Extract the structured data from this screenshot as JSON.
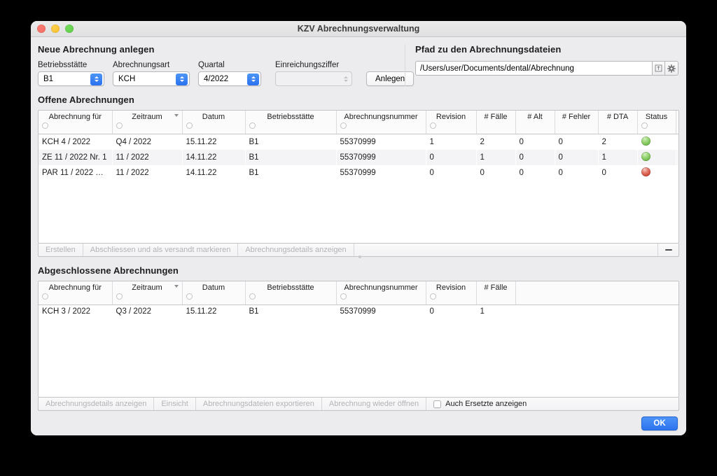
{
  "window": {
    "title": "KZV Abrechnungsverwaltung",
    "traffic_lights": [
      "close",
      "minimize",
      "zoom"
    ],
    "accent_color": "#2d74f0"
  },
  "new_billing": {
    "section_title": "Neue Abrechnung anlegen",
    "fields": [
      {
        "label": "Betriebsstätte",
        "value": "B1",
        "type": "popup"
      },
      {
        "label": "Abrechnungsart",
        "value": "KCH",
        "type": "popup"
      },
      {
        "label": "Quartal",
        "value": "4/2022",
        "type": "popup"
      },
      {
        "label": "Einreichungsziffer",
        "value": "",
        "type": "stepper",
        "disabled": true
      }
    ],
    "create_button": "Anlegen"
  },
  "path_panel": {
    "section_title": "Pfad zu den Abrechnungsdateien",
    "path_value": "/Users/user/Documents/dental/Abrechnung",
    "reveal_icon": "reveal-in-finder-icon",
    "settings_icon": "gear-icon"
  },
  "open_billings": {
    "section_title": "Offene Abrechnungen",
    "columns": [
      {
        "label": "Abrechnung für",
        "filter": true,
        "sorted": false
      },
      {
        "label": "Zeitraum",
        "filter": true,
        "sorted": true
      },
      {
        "label": "Datum",
        "filter": true,
        "sorted": false
      },
      {
        "label": "Betriebsstätte",
        "filter": true,
        "sorted": false
      },
      {
        "label": "Abrechnungsnummer",
        "filter": true,
        "sorted": false
      },
      {
        "label": "Revision",
        "filter": true,
        "sorted": false
      },
      {
        "label": "# Fälle",
        "filter": false,
        "sorted": false
      },
      {
        "label": "# Alt",
        "filter": false,
        "sorted": false
      },
      {
        "label": "# Fehler",
        "filter": false,
        "sorted": false
      },
      {
        "label": "# DTA",
        "filter": false,
        "sorted": false
      },
      {
        "label": "Status",
        "filter": true,
        "sorted": false
      },
      {
        "label": "",
        "filter": false,
        "sorted": false
      }
    ],
    "rows": [
      {
        "abrechnung_fuer": "KCH 4 / 2022",
        "zeitraum": "Q4 / 2022",
        "datum": "15.11.22",
        "betriebsstaette": "B1",
        "abrechnungsnummer": "55370999",
        "revision": "1",
        "faelle": "2",
        "alt": "0",
        "fehler": "0",
        "dta": "2",
        "status": "green"
      },
      {
        "abrechnung_fuer": "ZE 11 / 2022 Nr. 1",
        "zeitraum": "11 / 2022",
        "datum": "14.11.22",
        "betriebsstaette": "B1",
        "abrechnungsnummer": "55370999",
        "revision": "0",
        "faelle": "1",
        "alt": "0",
        "fehler": "0",
        "dta": "1",
        "status": "green"
      },
      {
        "abrechnung_fuer": "PAR 11 / 2022 Nr...",
        "zeitraum": "11 / 2022",
        "datum": "14.11.22",
        "betriebsstaette": "B1",
        "abrechnungsnummer": "55370999",
        "revision": "0",
        "faelle": "0",
        "alt": "0",
        "fehler": "0",
        "dta": "0",
        "status": "red"
      }
    ],
    "toolbar": {
      "buttons": [
        {
          "label": "Erstellen",
          "disabled": true
        },
        {
          "label": "Abschliessen und als versandt markieren",
          "disabled": true
        },
        {
          "label": "Abrechnungsdetails anzeigen",
          "disabled": true
        }
      ],
      "remove_button": "minus-icon"
    }
  },
  "closed_billings": {
    "section_title": "Abgeschlossene Abrechnungen",
    "columns": [
      {
        "label": "Abrechnung für",
        "filter": true,
        "sorted": false
      },
      {
        "label": "Zeitraum",
        "filter": true,
        "sorted": true
      },
      {
        "label": "Datum",
        "filter": true,
        "sorted": false
      },
      {
        "label": "Betriebsstätte",
        "filter": true,
        "sorted": false
      },
      {
        "label": "Abrechnungsnummer",
        "filter": true,
        "sorted": false
      },
      {
        "label": "Revision",
        "filter": true,
        "sorted": false
      },
      {
        "label": "# Fälle",
        "filter": false,
        "sorted": false
      },
      {
        "label": "",
        "filter": false,
        "sorted": false
      }
    ],
    "rows": [
      {
        "abrechnung_fuer": "KCH 3 / 2022",
        "zeitraum": "Q3 / 2022",
        "datum": "15.11.22",
        "betriebsstaette": "B1",
        "abrechnungsnummer": "55370999",
        "revision": "0",
        "faelle": "1"
      }
    ],
    "toolbar": {
      "buttons": [
        {
          "label": "Abrechnungsdetails anzeigen",
          "disabled": true
        },
        {
          "label": "Einsicht",
          "disabled": true
        },
        {
          "label": "Abrechnungsdateien exportieren",
          "disabled": true
        },
        {
          "label": "Abrechnung wieder öffnen",
          "disabled": true
        }
      ],
      "checkbox_label": "Auch Ersetzte anzeigen",
      "checkbox_checked": false
    }
  },
  "footer": {
    "ok_label": "OK"
  }
}
